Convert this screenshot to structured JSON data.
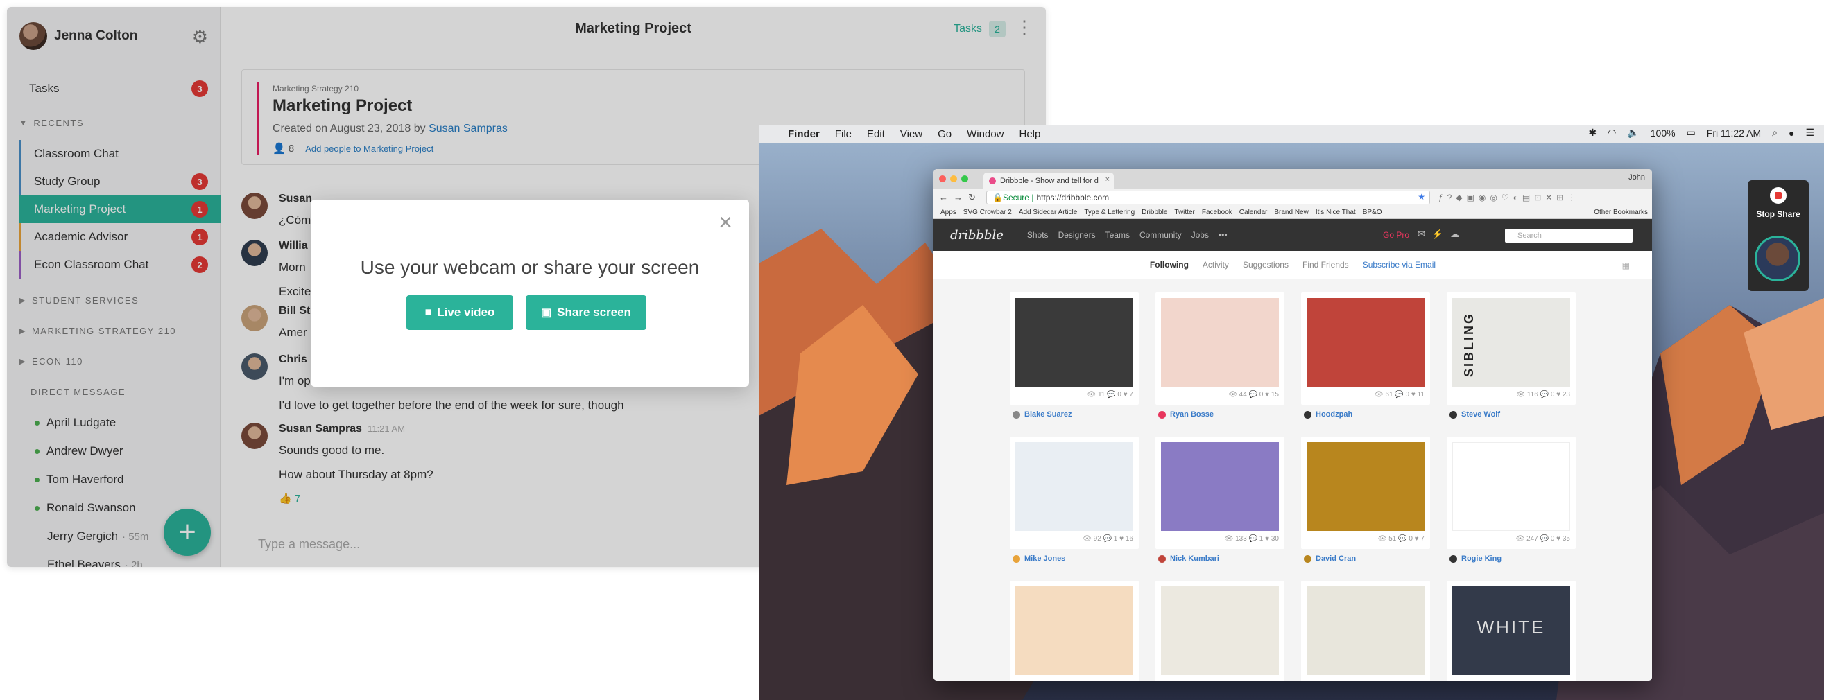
{
  "chat": {
    "user_name": "Jenna Colton",
    "tasks_label": "Tasks",
    "tasks_badge": "3",
    "recents_label": "RECENTS",
    "recents": [
      {
        "label": "Classroom Chat",
        "badge": "",
        "color": "#4a90c8"
      },
      {
        "label": "Study Group",
        "badge": "3",
        "color": "#4a90c8"
      },
      {
        "label": "Marketing Project",
        "badge": "1",
        "color": "#2bb39a"
      },
      {
        "label": "Academic Advisor",
        "badge": "1",
        "color": "#e8a33a"
      },
      {
        "label": "Econ Classroom Chat",
        "badge": "2",
        "color": "#9c5fc4"
      }
    ],
    "sections": [
      "STUDENT SERVICES",
      "MARKETING STRATEGY 210",
      "ECON 110"
    ],
    "dm_label": "DIRECT MESSAGE",
    "dms": [
      {
        "name": "April Ludgate",
        "ago": ""
      },
      {
        "name": "Andrew Dwyer",
        "ago": ""
      },
      {
        "name": "Tom Haverford",
        "ago": ""
      },
      {
        "name": "Ronald Swanson",
        "ago": ""
      },
      {
        "name": "Jerry Gergich",
        "ago": "· 55m"
      },
      {
        "name": "Ethel Beavers",
        "ago": "· 2h"
      }
    ],
    "header": {
      "title": "Marketing Project",
      "tasks_label": "Tasks",
      "tasks_count": "2"
    },
    "project": {
      "subtitle": "Marketing Strategy 210",
      "title": "Marketing Project",
      "created_prefix": "Created on August 23, 2018 by ",
      "created_by": "Susan Sampras",
      "people_count": "8",
      "add_people": "Add people to Marketing Project"
    },
    "messages": [
      {
        "name": "Susan",
        "time": "",
        "lines": [
          "¿Cóm"
        ]
      },
      {
        "name": "Willia",
        "time": "",
        "lines": [
          "Morn",
          "Excite"
        ]
      },
      {
        "name": "Bill St",
        "time": "",
        "lines": [
          "Amer"
        ]
      },
      {
        "name": "Chris",
        "time": "",
        "lines": [
          "I'm open this weekend if you want to meet in person... If we meet remotely here in Pro",
          "I'd love to get together before the end of the week for sure, though"
        ]
      },
      {
        "name": "Susan Sampras",
        "time": "11:21 AM",
        "lines": [
          "Sounds good to me.",
          "How about Thursday at 8pm?",
          "👍 7"
        ]
      }
    ],
    "input_placeholder": "Type a message...",
    "modal": {
      "title": "Use your webcam or share your screen",
      "live_video": "Live video",
      "share_screen": "Share screen"
    }
  },
  "mac": {
    "menu": [
      "Finder",
      "File",
      "Edit",
      "View",
      "Go",
      "Window",
      "Help"
    ],
    "battery": "100%",
    "clock": "Fri 11:22 AM",
    "stop_share": "Stop Share",
    "browser": {
      "tab_title": "Dribbble - Show and tell for d",
      "user": "John",
      "secure": "Secure",
      "url": "https://dribbble.com",
      "bookmarks": [
        "Apps",
        "SVG Crowbar 2",
        "Add Sidecar Article",
        "Type & Lettering",
        "Dribbble",
        "Twitter",
        "Facebook",
        "Calendar",
        "Brand New",
        "It's Nice That",
        "BP&O"
      ],
      "other_bookmarks": "Other Bookmarks",
      "nav": [
        "Shots",
        "Designers",
        "Teams",
        "Community",
        "Jobs",
        "•••"
      ],
      "logo": "dribbble",
      "gopro": "Go Pro",
      "search": "Search",
      "subnav": [
        "Following",
        "Activity",
        "Suggestions",
        "Find Friends",
        "Subscribe via Email"
      ],
      "shots": [
        {
          "player": "Blake Suarez",
          "stats": "👁 11  💬 0  ♥ 7",
          "bg": "#3a3a3a",
          "pc": "#888"
        },
        {
          "player": "Ryan Bosse",
          "stats": "👁 44  💬 0  ♥ 15",
          "bg": "#f2d6cc",
          "pc": "#e8365d"
        },
        {
          "player": "Hoodzpah",
          "stats": "👁 61  💬 0  ♥ 11",
          "bg": "#c0443a",
          "pc": "#333"
        },
        {
          "player": "Steve Wolf",
          "stats": "👁 116  💬 0  ♥ 23",
          "bg": "#e8e8e4",
          "pc": "#333"
        },
        {
          "player": "Mike Jones",
          "stats": "👁 92  💬 1  ♥ 16",
          "bg": "#e9eef3",
          "pc": "#e8a33a"
        },
        {
          "player": "Nick Kumbari",
          "stats": "👁 133  💬 1  ♥ 30",
          "bg": "#8a7bc4",
          "pc": "#c0443a"
        },
        {
          "player": "David Cran",
          "stats": "👁 51  💬 0  ♥ 7",
          "bg": "#b8861e",
          "pc": "#b8861e"
        },
        {
          "player": "Rogie King",
          "stats": "👁 247  💬 0  ♥ 35",
          "bg": "#ffffff",
          "pc": "#333"
        },
        {
          "player": "",
          "stats": "",
          "bg": "#f5dcc0",
          "pc": "#999"
        },
        {
          "player": "",
          "stats": "",
          "bg": "#ece9e0",
          "pc": "#999"
        },
        {
          "player": "",
          "stats": "",
          "bg": "#e8e6dc",
          "pc": "#999"
        },
        {
          "player": "",
          "stats": "",
          "bg": "#333a4a",
          "pc": "#999"
        }
      ],
      "tile_text_sibling": "SIBLING",
      "tile_text_white": "WHITE"
    }
  }
}
